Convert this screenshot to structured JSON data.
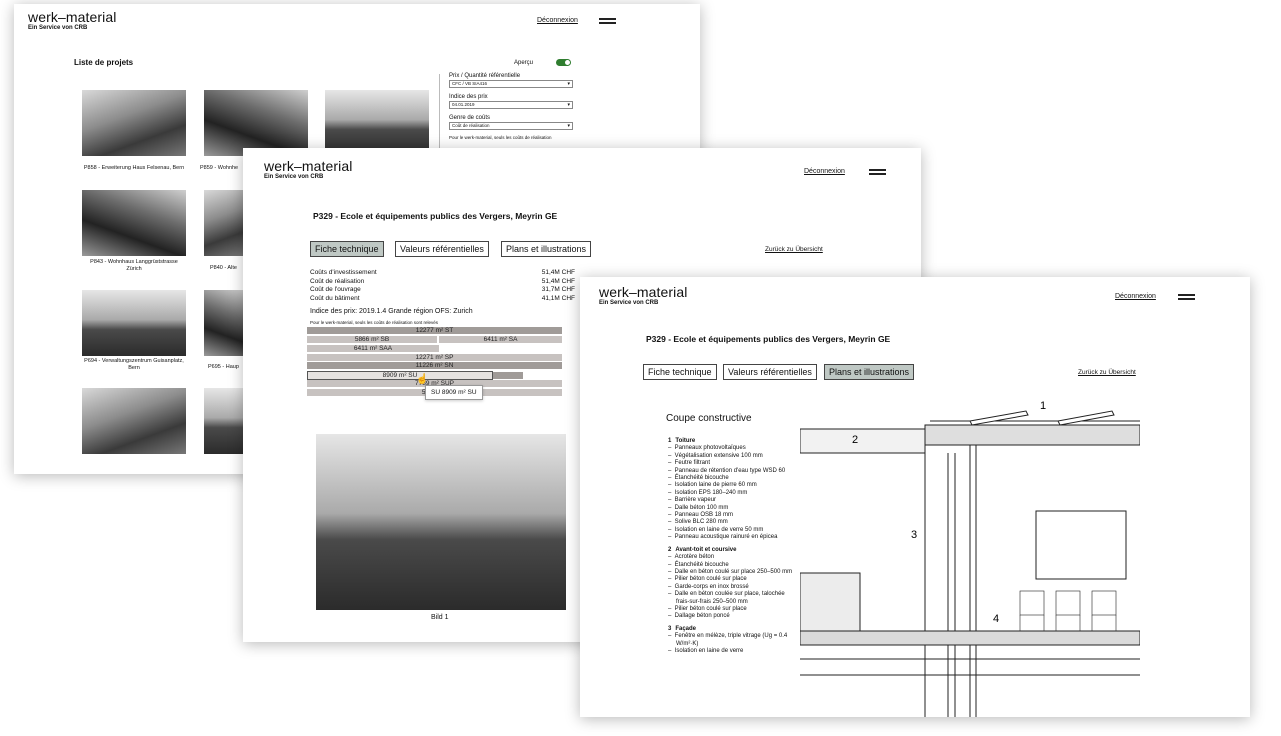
{
  "brand": {
    "name": "werk–material",
    "sub": "Ein Service von CRB"
  },
  "nav": {
    "logout": "Déconnexion"
  },
  "win1": {
    "title": "Liste de projets",
    "apercu": "Aperçu",
    "filters": [
      {
        "label": "Prix / Quantité référentielle",
        "value": "CFC / VB SIA416"
      },
      {
        "label": "Indice des prix",
        "value": "04.01.2019"
      },
      {
        "label": "Genre de coûts",
        "value": "Coût de réalisation"
      }
    ],
    "note": "Pour le werk-material, seuls les coûts de réalisation",
    "projects": [
      {
        "caption": "P858 - Erweiterung Haus Felsenau, Bern"
      },
      {
        "caption": "P859 - Wohnhe"
      },
      {
        "caption": ""
      },
      {
        "caption": "P843 - Wohnhaus Langgrüststrasse Zürich"
      },
      {
        "caption": "P840 - Alte"
      },
      {
        "caption": "P694 - Verwaltungszentrum Guisanplatz, Bern"
      },
      {
        "caption": "P695 - Haup"
      }
    ]
  },
  "win2": {
    "project_title": "P329 - Ecole et équipements publics des Vergers, Meyrin GE",
    "tabs": [
      "Fiche technique",
      "Valeurs référentielles",
      "Plans et illustrations"
    ],
    "back": "Zurück zu Übersicht",
    "costs": [
      {
        "label": "Coûts d'investissement",
        "value": "51,4M CHF"
      },
      {
        "label": "Coût de réalisation",
        "value": "51,4M CHF"
      },
      {
        "label": "Coût de l'ouvrage",
        "value": "31,7M CHF"
      },
      {
        "label": "Coût du bâtiment",
        "value": "41,1M CHF"
      }
    ],
    "price_index": "Indice des prix: 2019.1.4 Grande région OFS: Zurich",
    "note": "Pour le werk-material, seuls les coûts de réalisation sont relevés",
    "bars": [
      {
        "label": "12277 m² ST"
      },
      {
        "label": "5866 m² SB"
      },
      {
        "label": "6411 m² SA"
      },
      {
        "label": "6411 m² SAA"
      },
      {
        "label": "12271 m² SP"
      },
      {
        "label": "11226 m² SN"
      },
      {
        "label": "8909 m² SU"
      },
      {
        "label": "7789 m² SUP"
      },
      {
        "label": "56680 m"
      }
    ],
    "tooltip": "SU 8909 m² SU",
    "figure_caption": "Bild 1"
  },
  "win3": {
    "project_title": "P329 - Ecole et équipements publics des Vergers, Meyrin GE",
    "tabs": [
      "Fiche technique",
      "Valeurs référentielles",
      "Plans et illustrations"
    ],
    "back": "Zurück zu Übersicht",
    "section_title": "Coupe constructive",
    "legend": [
      {
        "num": "1",
        "title": "Toiture",
        "items": [
          "Panneaux photovoltaïques",
          "Végétalisation extensive 100 mm",
          "Feutre filtrant",
          "Panneau de rétention d'eau type WSD 60",
          "Étanchéité bicouche",
          "Isolation laine de pierre 60 mm",
          "Isolation EPS 180–240 mm",
          "Barrière vapeur",
          "Dalle béton 100 mm",
          "Panneau OSB 18 mm",
          "Solive BLC 280 mm",
          "Isolation en laine de verre 50 mm",
          "Panneau acoustique rainuré en épicea"
        ]
      },
      {
        "num": "2",
        "title": "Avant-toit et coursive",
        "items": [
          "Acrotère béton",
          "Étanchéité bicouche",
          "Dalle en béton coulé sur place 250–500 mm",
          "Pilier béton coulé sur place",
          "Garde-corps en inox brossé",
          "Dalle en béton coulée sur place, talochée frais-sur-frais 250–500 mm",
          "Pilier béton coulé sur place",
          "Dallage béton poncé"
        ]
      },
      {
        "num": "3",
        "title": "Façade",
        "items": [
          "Fenêtre en mélèze, triple vitrage (Ug = 0.4 W/m²·K)",
          "Isolation en laine de verre"
        ]
      }
    ],
    "drawing_labels": [
      "1",
      "2",
      "3",
      "4"
    ]
  }
}
